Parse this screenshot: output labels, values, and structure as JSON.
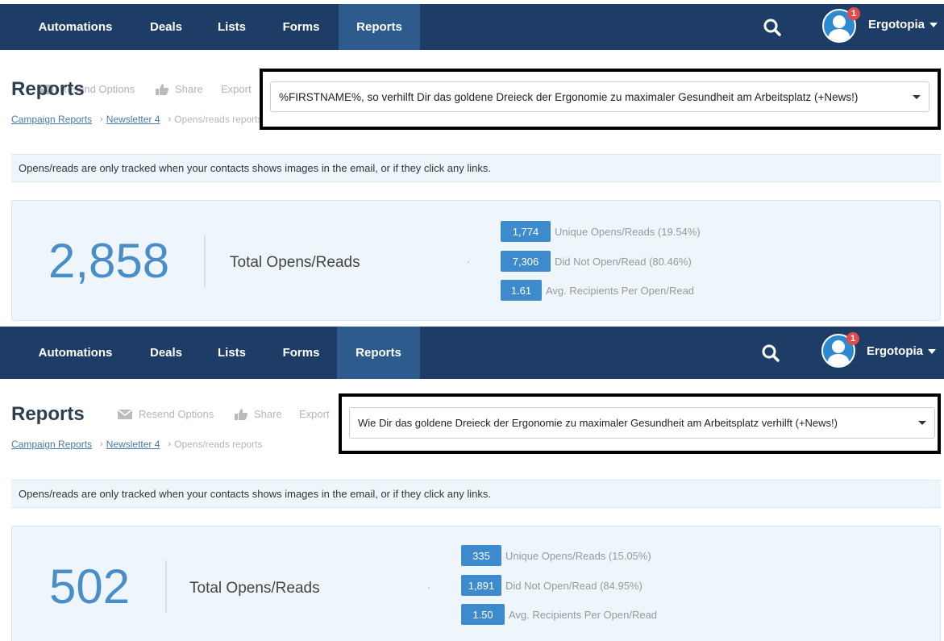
{
  "panels": [
    {
      "nav": {
        "items": [
          "Automations",
          "Deals",
          "Lists",
          "Forms",
          "Reports"
        ],
        "active": "Reports",
        "notification_count": "1",
        "user": "Ergotopia"
      },
      "page_title": "Reports",
      "toolbar": {
        "resend": "Resend Options",
        "share": "Share",
        "export": "Export"
      },
      "breadcrumb": {
        "campaign_reports": "Campaign Reports",
        "newsletter": "Newsletter 4",
        "current": "Opens/reads reports"
      },
      "subject_select": {
        "value": "%FIRSTNAME%, so verhilft Dir das goldene Dreieck der Ergonomie zu maximaler Gesundheit am Arbeitsplatz (+News!)"
      },
      "info": "Opens/reads are only tracked when your contacts shows images in the email, or if they click any links.",
      "stats": {
        "total": "2,858",
        "total_label": "Total Opens/Reads",
        "rows": [
          {
            "value": "1,774",
            "label": "Unique Opens/Reads (19.54%)"
          },
          {
            "value": "7,306",
            "label": "Did Not Open/Read (80.46%)"
          },
          {
            "value": "1.61",
            "label": "Avg. Recipients Per Open/Read"
          }
        ]
      }
    },
    {
      "nav": {
        "items": [
          "Automations",
          "Deals",
          "Lists",
          "Forms",
          "Reports"
        ],
        "active": "Reports",
        "notification_count": "1",
        "user": "Ergotopia"
      },
      "page_title": "Reports",
      "toolbar": {
        "resend": "Resend Options",
        "share": "Share",
        "export": "Export"
      },
      "breadcrumb": {
        "campaign_reports": "Campaign Reports",
        "newsletter": "Newsletter 4",
        "current": "Opens/reads reports"
      },
      "subject_select": {
        "value": "Wie Dir das goldene Dreieck der Ergonomie zu maximaler Gesundheit am Arbeitsplatz verhilft (+News!)"
      },
      "info": "Opens/reads are only tracked when your contacts shows images in the email, or if they click any links.",
      "stats": {
        "total": "502",
        "total_label": "Total Opens/Reads",
        "rows": [
          {
            "value": "335",
            "label": "Unique Opens/Reads (15.05%)"
          },
          {
            "value": "1,891",
            "label": "Did Not Open/Read (84.95%)"
          },
          {
            "value": "1.50",
            "label": "Avg. Recipients Per Open/Read"
          }
        ]
      }
    }
  ],
  "colors": {
    "navbar": "#1e3d66",
    "nav_active": "#2d5b8d",
    "accent": "#3d8bcd",
    "big_number": "#4a8ec9",
    "info_bg": "#eef6fc",
    "badge_red": "#e24b4b"
  },
  "icons": [
    "search-icon",
    "user-avatar-icon",
    "envelope-icon",
    "thumbs-up-icon",
    "caret-down-icon"
  ]
}
